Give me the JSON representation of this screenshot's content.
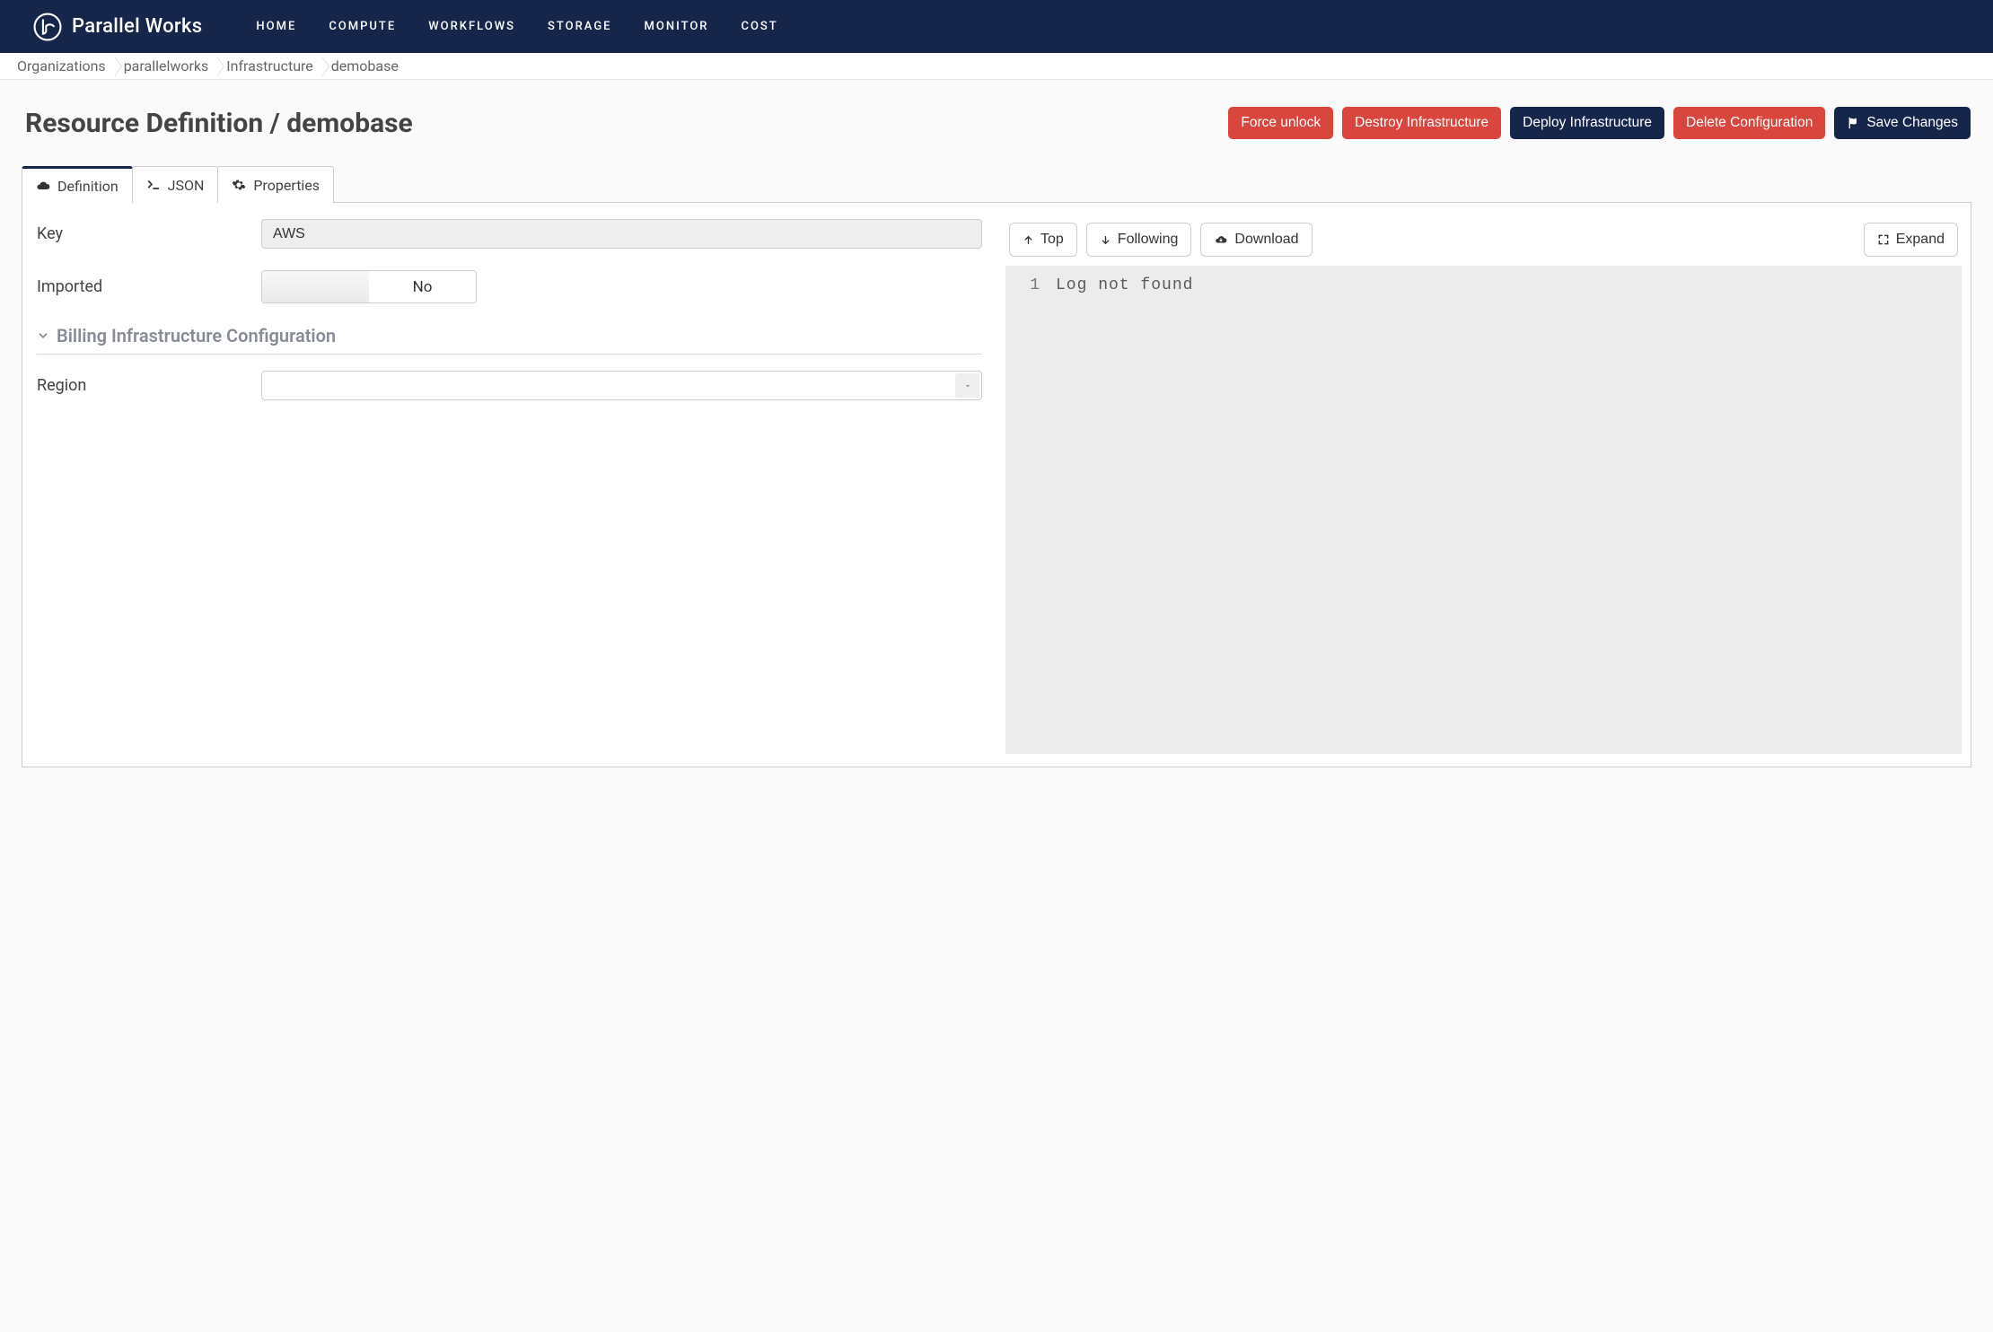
{
  "brand": {
    "name": "Parallel Works"
  },
  "nav": {
    "items": [
      "HOME",
      "COMPUTE",
      "WORKFLOWS",
      "STORAGE",
      "MONITOR",
      "COST"
    ]
  },
  "breadcrumb": [
    "Organizations",
    "parallelworks",
    "Infrastructure",
    "demobase"
  ],
  "page": {
    "title": "Resource Definition / demobase"
  },
  "actions": {
    "force_unlock": "Force unlock",
    "destroy": "Destroy Infrastructure",
    "deploy": "Deploy Infrastructure",
    "delete": "Delete Configuration",
    "save": "Save Changes"
  },
  "tabs": {
    "definition": "Definition",
    "json": "JSON",
    "properties": "Properties"
  },
  "form": {
    "key_label": "Key",
    "key_value": "AWS",
    "imported_label": "Imported",
    "imported_value_no": "No",
    "billing_section": "Billing Infrastructure Configuration",
    "region_label": "Region",
    "region_value": ""
  },
  "log_toolbar": {
    "top": "Top",
    "following": "Following",
    "download": "Download",
    "expand": "Expand"
  },
  "log": {
    "lines": [
      {
        "n": "1",
        "text": "Log not found"
      }
    ]
  }
}
